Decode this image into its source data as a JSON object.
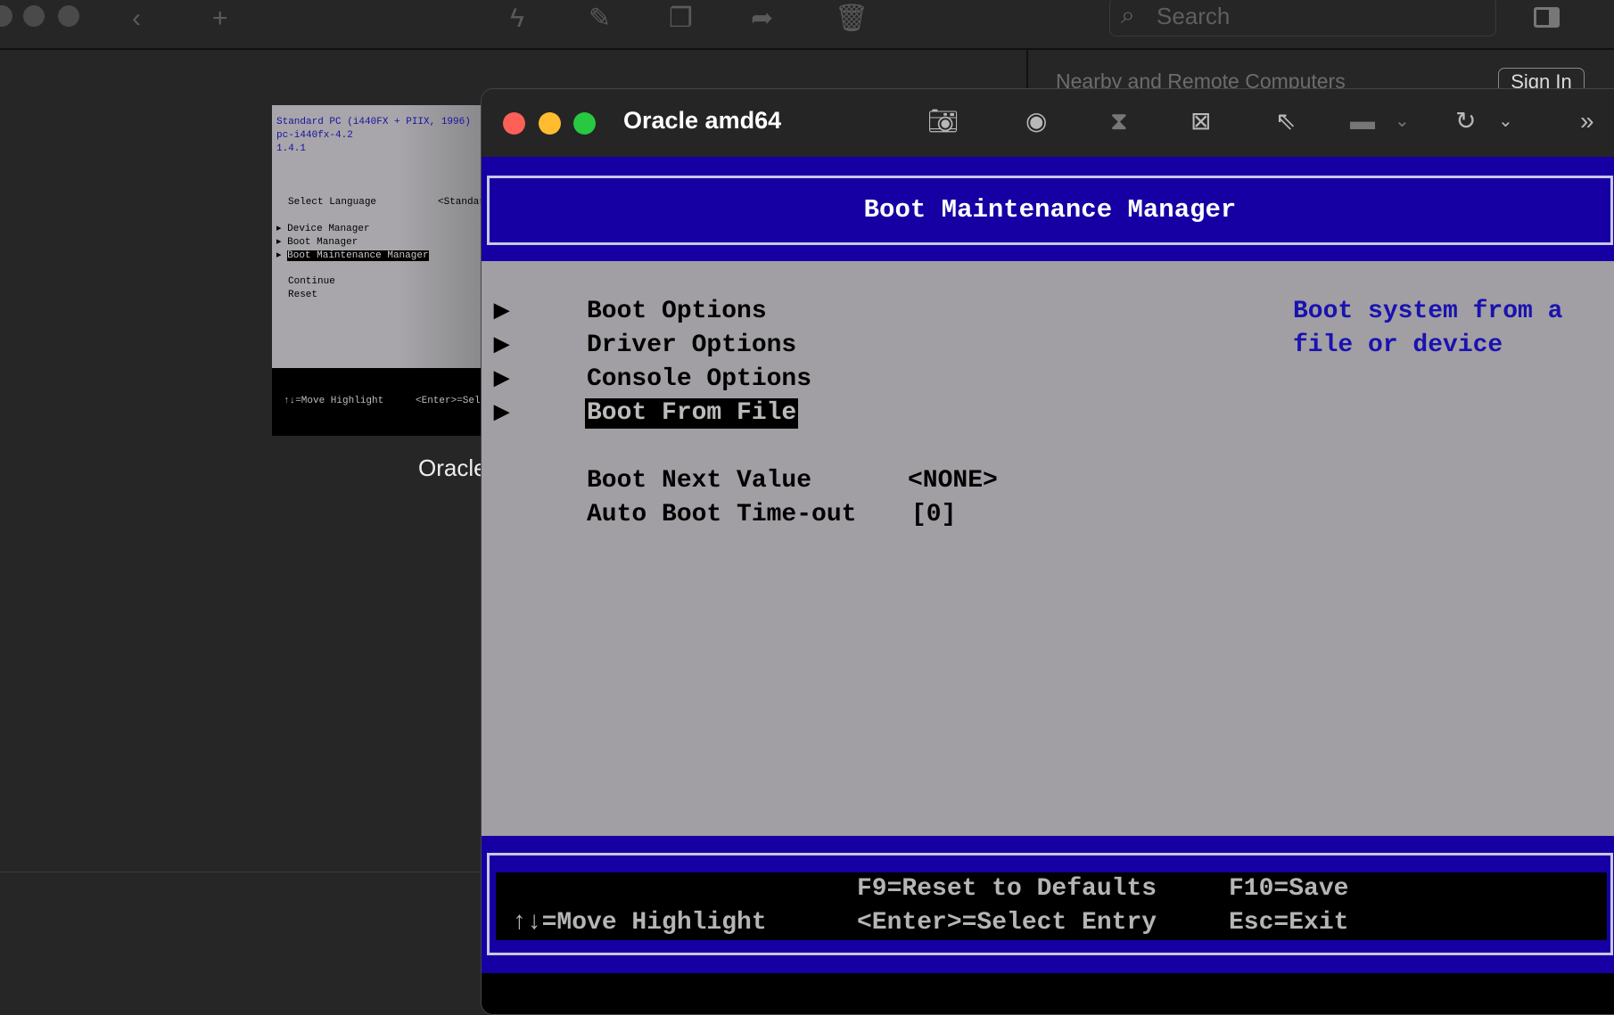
{
  "app_toolbar": {
    "search_placeholder": "Search"
  },
  "sidebar": {
    "section_title": "Nearby and Remote Computers",
    "sign_in_label": "Sign In"
  },
  "thumbnail": {
    "caption": "Oracle",
    "lines": [
      "Standard PC (i440FX + PIIX, 1996)",
      "pc-i440fx-4.2",
      "1.4.1"
    ],
    "select_language_label": "Select Language",
    "select_language_value": "<Standard English>",
    "menu": [
      "Device Manager",
      "Boot Manager",
      "Boot Maintenance Manager"
    ],
    "actions": [
      "Continue",
      "Reset"
    ],
    "footer": [
      "↑↓=Move Highlight",
      "<Enter>=Select Entry"
    ]
  },
  "vm_window": {
    "title": "Oracle amd64"
  },
  "bios": {
    "header": "Boot Maintenance Manager",
    "menu": [
      "Boot Options",
      "Driver Options",
      "Console Options",
      "Boot From File"
    ],
    "selected_index": 3,
    "help_text": [
      "Boot system from a",
      "file or device"
    ],
    "settings": [
      {
        "label": "Boot Next Value",
        "value": "<NONE>"
      },
      {
        "label": "Auto Boot Time-out",
        "value": "[0]"
      }
    ],
    "footer": {
      "reset": "F9=Reset to Defaults",
      "save": "F10=Save",
      "move": "↑↓=Move Highlight",
      "select": "<Enter>=Select Entry",
      "exit": "Esc=Exit"
    },
    "colors": {
      "blue": "#1600a4",
      "grey": "#a19fa3",
      "help": "#1a12b0"
    }
  }
}
